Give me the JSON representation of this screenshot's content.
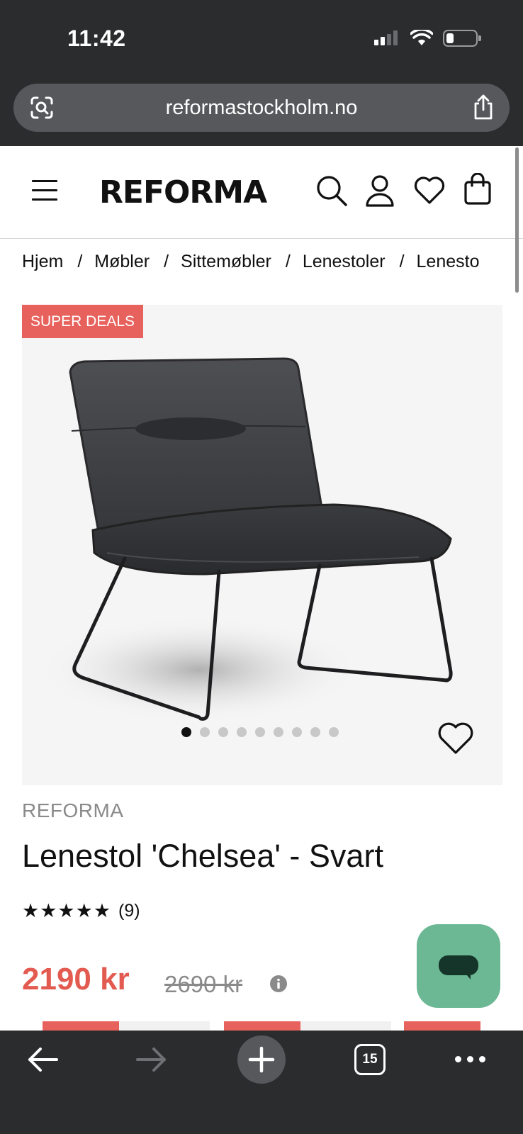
{
  "status": {
    "time": "11:42"
  },
  "browser": {
    "url": "reformastockholm.no",
    "tab_count": "15"
  },
  "site": {
    "logo": "REFORMA"
  },
  "breadcrumb": {
    "items": [
      "Hjem",
      "Møbler",
      "Sittemøbler",
      "Lenestoler",
      "Lenesto"
    ],
    "separator": "/"
  },
  "product": {
    "badge": "SUPER DEALS",
    "brand": "REFORMA",
    "title": "Lenestol 'Chelsea' - Svart",
    "stars": "★★★★★",
    "rating_value": 5,
    "review_count": "(9)",
    "price": "2190 kr",
    "old_price": "2690 kr",
    "image_count": 9,
    "active_image": 1
  },
  "colors": {
    "chrome": "#2b2c2e",
    "url_pill": "#57585c",
    "sale": "#e35a50",
    "badge": "#e8625d",
    "chat": "#6cb894"
  },
  "icons": {
    "header": [
      "menu-icon",
      "search-icon",
      "account-icon",
      "wishlist-icon",
      "cart-icon"
    ],
    "browser": [
      "lens-icon",
      "share-icon",
      "back-icon",
      "forward-icon",
      "new-tab-icon",
      "tabs-icon",
      "more-icon"
    ],
    "other": [
      "heart-icon",
      "info-icon",
      "chat-icon"
    ]
  }
}
